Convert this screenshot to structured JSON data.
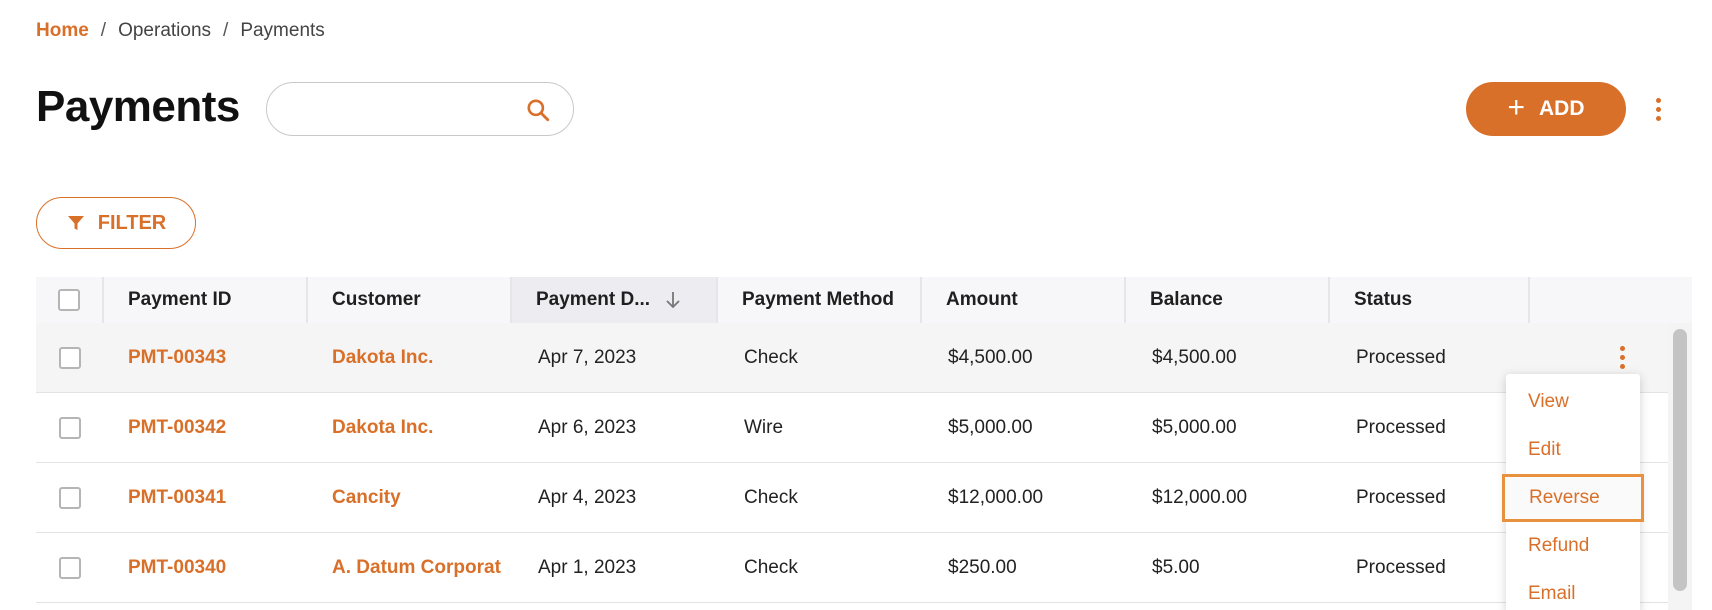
{
  "breadcrumb": {
    "home": "Home",
    "separator": "/",
    "operations": "Operations",
    "current": "Payments"
  },
  "page": {
    "title": "Payments"
  },
  "search": {
    "value": "",
    "placeholder": ""
  },
  "toolbar": {
    "add_icon": "+",
    "add_label": "ADD",
    "filter_label": "FILTER"
  },
  "table": {
    "columns": [
      "Payment ID",
      "Customer",
      "Payment D...",
      "Payment Method",
      "Amount",
      "Balance",
      "Status"
    ],
    "sorted_column": "Payment D...",
    "sort_direction": "descending",
    "rows": [
      {
        "id": "PMT-00343",
        "customer": "Dakota Inc.",
        "date": "Apr 7, 2023",
        "method": "Check",
        "amount": "$4,500.00",
        "balance": "$4,500.00",
        "status": "Processed"
      },
      {
        "id": "PMT-00342",
        "customer": "Dakota Inc.",
        "date": "Apr 6, 2023",
        "method": "Wire",
        "amount": "$5,000.00",
        "balance": "$5,000.00",
        "status": "Processed"
      },
      {
        "id": "PMT-00341",
        "customer": "Cancity",
        "date": "Apr 4, 2023",
        "method": "Check",
        "amount": "$12,000.00",
        "balance": "$12,000.00",
        "status": "Processed"
      },
      {
        "id": "PMT-00340",
        "customer": "A. Datum Corporat",
        "date": "Apr 1, 2023",
        "method": "Check",
        "amount": "$250.00",
        "balance": "$5.00",
        "status": "Processed"
      }
    ]
  },
  "row_menu": {
    "items": [
      "View",
      "Edit",
      "Reverse",
      "Refund",
      "Email"
    ],
    "focused": "Reverse"
  },
  "colors": {
    "accent": "#d9702a",
    "header_bg": "#f7f7f9",
    "sorted_header_bg": "#ececf1",
    "focus_outline": "#e8913f"
  },
  "icons": {
    "search": "search-icon",
    "add": "plus-icon",
    "filter": "filter-icon",
    "sort": "arrow-down-icon",
    "more": "more-vertical-icon"
  }
}
